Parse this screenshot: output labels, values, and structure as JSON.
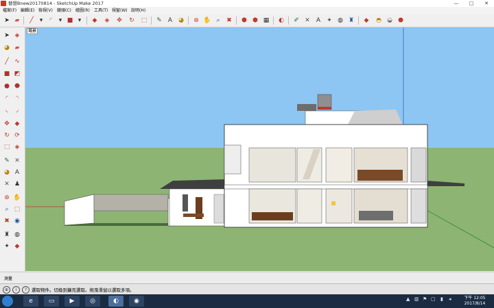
{
  "window": {
    "title": "替想Bnew20170814 - SketchUp Make 2017",
    "minimize": "—",
    "maximize": "□",
    "close": "✕"
  },
  "menu": [
    "檔案(F)",
    "編輯(E)",
    "檢視(V)",
    "鏡頭(C)",
    "繪圖(R)",
    "工具(T)",
    "視窗(W)",
    "說明(H)"
  ],
  "viewport": {
    "scene_tab": "場景",
    "colors": {
      "sky": "#8dc6f2",
      "ground": "#8eb474",
      "wall": "#ffffff",
      "roof": "#3f3f3f"
    }
  },
  "measurements_label": "測量",
  "status_text": "選取物件。切換到擴充選取。拖曳滑鼠以選取多項。",
  "taskbar": {
    "clock_time": "下午 12:05",
    "clock_date": "2017/8/14"
  }
}
